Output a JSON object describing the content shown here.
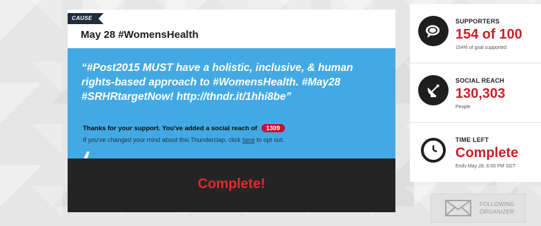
{
  "campaign": {
    "tag": "CAUSE",
    "title": "May 28 #WomensHealth",
    "tweet": "“#Post2015 MUST have a holistic, inclusive, & human rights-based approach to #WomensHealth. #May28 #SRHRtargetNow! http://thndr.it/1hhi8be”",
    "reach_message": "Thanks for your support. You've added a social reach of",
    "reach_value": "1309",
    "optout_prefix": "If you've changed your mind about this Thunderclap, click",
    "optout_link": "here",
    "optout_suffix": "to opt out.",
    "status": "Complete!"
  },
  "stats": {
    "supporters": {
      "label": "SUPPORTERS",
      "value": "154 of 100",
      "sub": "154% of goal supported",
      "icon": "speech-bubbles-icon"
    },
    "social_reach": {
      "label": "SOCIAL REACH",
      "value": "130,303",
      "sub": "People",
      "icon": "satellite-dish-icon"
    },
    "time_left": {
      "label": "TIME LEFT",
      "value": "Complete",
      "sub": "Ends May 28, 6:00 PM SGT",
      "icon": "clock-icon"
    }
  },
  "follow": {
    "line1": "FOLLOWING",
    "line2": "ORGANIZER",
    "icon": "envelope-icon"
  },
  "colors": {
    "tweet_bg": "#43a9e4",
    "accent_red": "#cc1f2b",
    "dark_panel": "#242424",
    "tag_bg": "#1f2d3d"
  }
}
